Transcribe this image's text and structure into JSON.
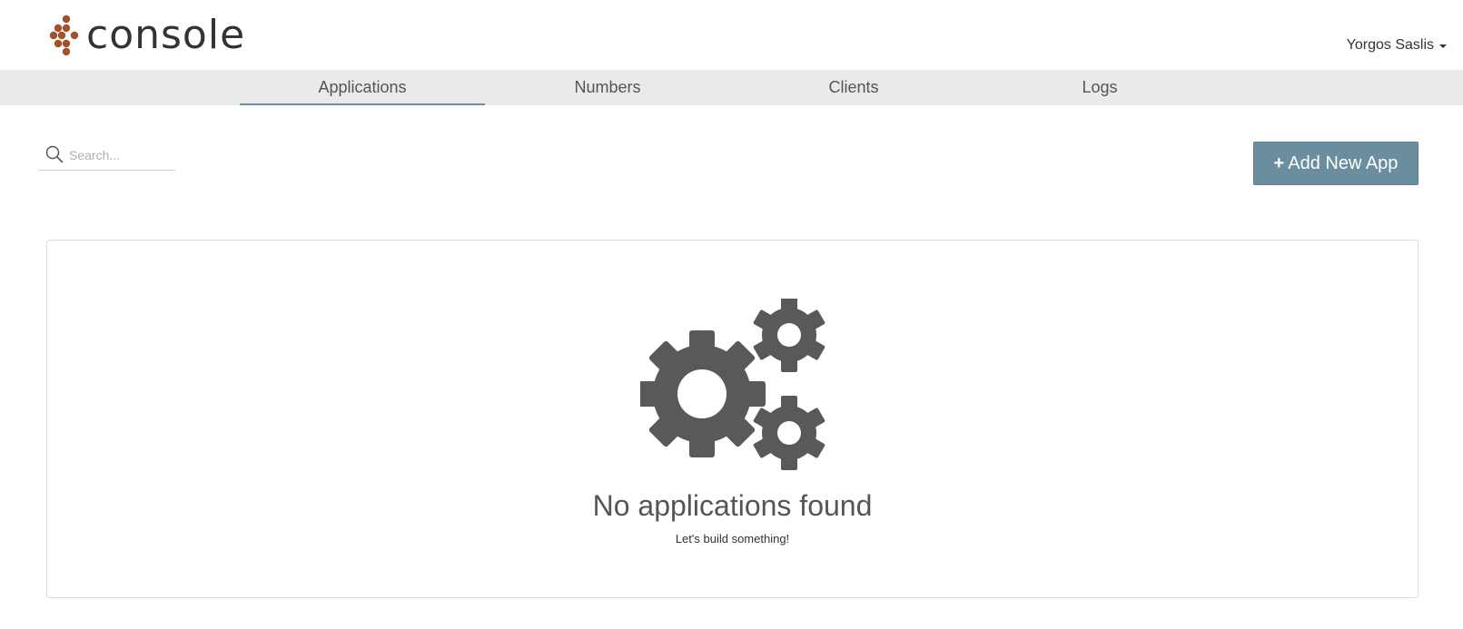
{
  "brand": {
    "name": "console",
    "accent": "#a0522d"
  },
  "user": {
    "name": "Yorgos Saslis"
  },
  "tabs": [
    {
      "label": "Applications",
      "active": true
    },
    {
      "label": "Numbers",
      "active": false
    },
    {
      "label": "Clients",
      "active": false
    },
    {
      "label": "Logs",
      "active": false
    }
  ],
  "search": {
    "placeholder": "Search...",
    "value": ""
  },
  "toolbar": {
    "add_plus": "+",
    "add_label": "Add New App",
    "button_color": "#6b8e9f"
  },
  "empty_state": {
    "icon": "gears-icon",
    "title": "No applications found",
    "subtitle": "Let's build something!",
    "icon_color": "#58595b"
  }
}
